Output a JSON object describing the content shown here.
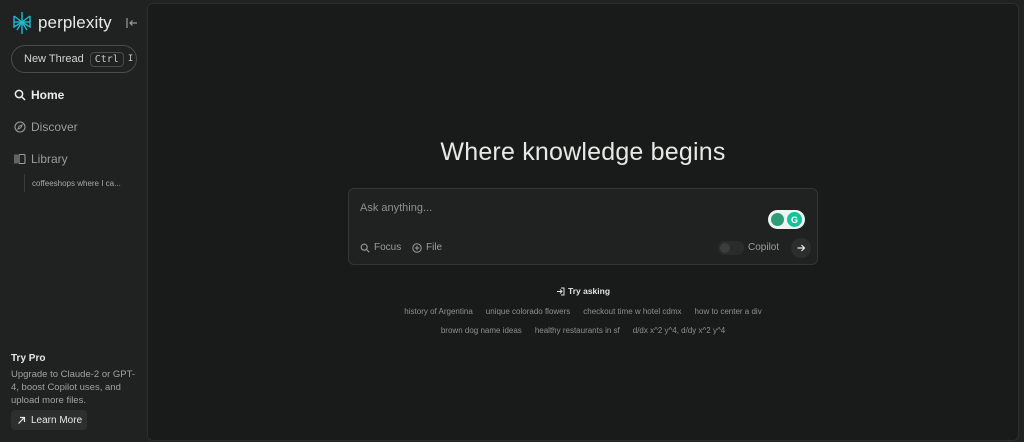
{
  "sidebar": {
    "logo_text": "perplexity",
    "new_thread": {
      "label": "New Thread",
      "shortcut_key": "Ctrl",
      "shortcut_extra": "I"
    },
    "nav": [
      {
        "label": "Home",
        "icon": "search-icon"
      },
      {
        "label": "Discover",
        "icon": "compass-icon"
      },
      {
        "label": "Library",
        "icon": "library-icon"
      }
    ],
    "library_threads": [
      "coffeeshops where I ca..."
    ],
    "pro": {
      "title": "Try Pro",
      "description": "Upgrade to Claude-2 or GPT-4, boost Copilot uses, and upload more files.",
      "button": "Learn More"
    }
  },
  "main": {
    "title": "Where knowledge begins",
    "ask": {
      "placeholder": "Ask anything...",
      "focus_label": "Focus",
      "file_label": "File",
      "copilot_label": "Copilot",
      "grammarly_letter": "G"
    },
    "try_asking": "Try asking",
    "suggestions_row1": [
      "history of Argentina",
      "unique colorado flowers",
      "checkout time w hotel cdmx",
      "how to center a div"
    ],
    "suggestions_row2": [
      "brown dog name ideas",
      "healthy restaurants in sf",
      "d/dx x^2 y^4, d/dy x^2 y^4"
    ]
  },
  "colors": {
    "sidebar_bg": "#202222",
    "main_bg": "#191a1a",
    "accent_teal": "#20808d",
    "grammarly_green": "#15c39a"
  }
}
